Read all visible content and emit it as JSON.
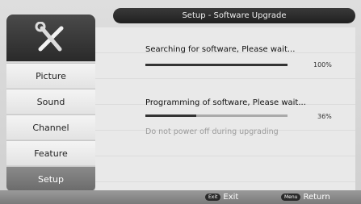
{
  "header": {
    "title": "Setup - Software Upgrade"
  },
  "sidebar": {
    "items": [
      {
        "label": "Picture"
      },
      {
        "label": "Sound"
      },
      {
        "label": "Channel"
      },
      {
        "label": "Feature"
      },
      {
        "label": "Setup",
        "active": true
      }
    ]
  },
  "main": {
    "search_text": "Searching for software, Please wait...",
    "search_progress": 1.0,
    "search_percent": "100%",
    "program_text": "Programming of software, Please wait...",
    "program_progress": 0.36,
    "program_percent": "36%",
    "warning": "Do not power off during upgrading"
  },
  "footer": {
    "exit_key": "Exit",
    "exit_label": "Exit",
    "menu_key": "Menu",
    "return_label": "Return"
  },
  "colors": {
    "active_item": "#7a7a7a",
    "header_bg": "#2b2b2b"
  }
}
